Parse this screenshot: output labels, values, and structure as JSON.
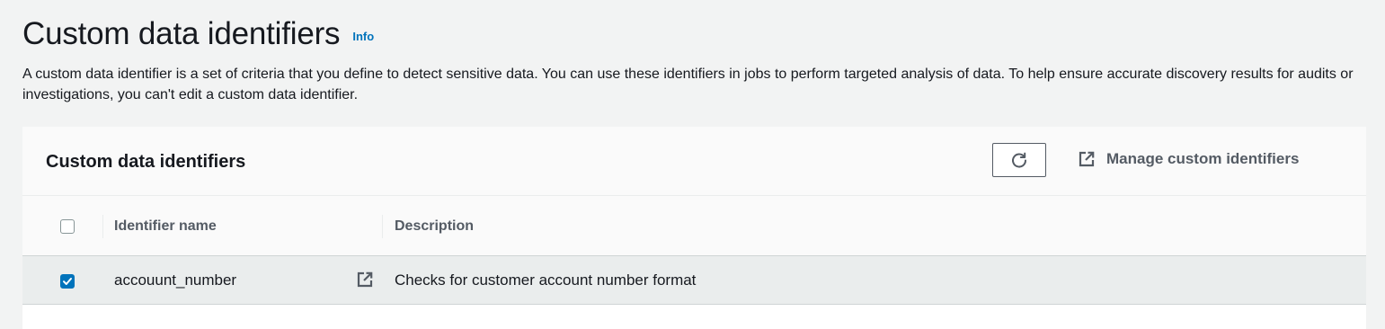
{
  "page": {
    "title": "Custom data identifiers",
    "info_label": "Info",
    "description": "A custom data identifier is a set of criteria that you define to detect sensitive data. You can use these identifiers in jobs to perform targeted analysis of data. To help ensure accurate discovery results for audits or investigations, you can't edit a custom data identifier."
  },
  "panel": {
    "title": "Custom data identifiers",
    "refresh_icon": "refresh-icon",
    "manage_label": "Manage custom identifiers",
    "manage_icon": "external-link-icon"
  },
  "table": {
    "columns": [
      "Identifier name",
      "Description"
    ],
    "select_all_checked": false,
    "rows": [
      {
        "checked": true,
        "name": "accouunt_number",
        "description": "Checks for customer account number format",
        "link_icon": "external-link-icon"
      }
    ]
  },
  "colors": {
    "accent": "#0073bb",
    "selected_row": "#eaeded",
    "background": "#f2f3f3"
  }
}
